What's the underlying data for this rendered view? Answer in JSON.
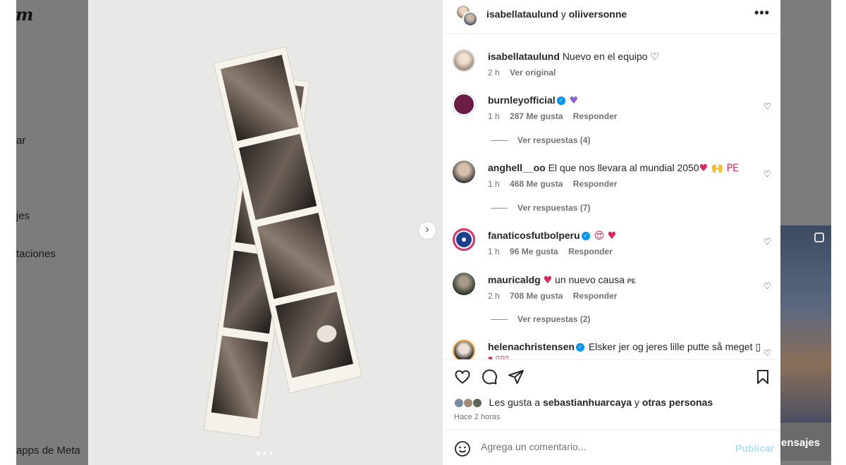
{
  "background": {
    "logo": "m",
    "nav_fragments": [
      "ar",
      "jes",
      "taciones"
    ],
    "footer_fragment": "apps de Meta",
    "messages_fragment": "ensajes"
  },
  "post": {
    "carousel_dots": 3,
    "active_dot": 0
  },
  "header": {
    "user1": "isabellataulund",
    "conjunction": "y",
    "user2": "oliiversonne"
  },
  "caption": {
    "username": "isabellataulund",
    "text": "Nuevo en el equipo ♡",
    "time": "2 h",
    "see_original": "Ver original"
  },
  "comments": [
    {
      "username": "burnleyofficial",
      "verified": true,
      "text": "",
      "emoji": "♥",
      "emoji_color": "purple",
      "time": "1 h",
      "likes": "287 Me gusta",
      "reply": "Responder",
      "replies": "Ver respuestas (4)"
    },
    {
      "username": "anghell__oo",
      "verified": false,
      "text": "El que nos llevara al mundial 2050",
      "emoji": "♥ 🙌 PE",
      "time": "1 h",
      "likes": "468 Me gusta",
      "reply": "Responder",
      "replies": "Ver respuestas (7)"
    },
    {
      "username": "fanaticosfutbolperu",
      "verified": true,
      "text": "",
      "emoji": "😍 ♥",
      "time": "1 h",
      "likes": "96 Me gusta",
      "reply": "Responder",
      "replies": ""
    },
    {
      "username": "mauricaldg",
      "verified": false,
      "text": "un nuevo causa",
      "emoji": "♥",
      "flag": "PE",
      "time": "2 h",
      "likes": "708 Me gusta",
      "reply": "Responder",
      "replies": "Ver respuestas (2)"
    },
    {
      "username": "helenachristensen",
      "verified": true,
      "text": "Elsker jer og jeres lille putte så meget ▯",
      "second_line": "♥ ▯▯▯"
    }
  ],
  "likes": {
    "prefix": "Les gusta a",
    "user": "sebastianhuarcaya",
    "conjunction": "y",
    "others": "otras personas",
    "time_ago": "Hace 2 horas"
  },
  "add_comment": {
    "placeholder": "Agrega un comentario...",
    "publish": "Publicar"
  },
  "colors": {
    "verified": "#0095f6",
    "publish_disabled": "#b2dffc",
    "heart_red": "#e0245e",
    "heart_purple": "#8a63d2"
  }
}
